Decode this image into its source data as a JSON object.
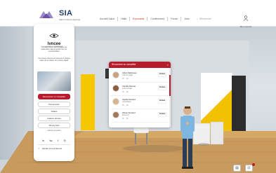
{
  "brand": {
    "logo_text": "SIA",
    "logo_sub": "Salon Internet Agricole"
  },
  "nav": {
    "items": [
      "Accueil Salon",
      "Halls",
      "Exposants",
      "Conférences",
      "Forum",
      "Jobs"
    ],
    "active_index": 2,
    "search_label": "Recherche",
    "account_label": "Mon compte"
  },
  "exhibitor": {
    "logo_text": "lvncee",
    "logo_sub": "CONSEIL & INGÉNIERIE",
    "desc1": "IVNCEE conseil, accompagne vos partenaires dans la gestion de vos communication.",
    "desc2": "Une équipe d'expert est présente à chaque étape de la création du contenu digital.",
    "primary_button": "Rencontrer un conseiller",
    "buttons": [
      "Documents",
      "Vidéos",
      "Galerie photos",
      "Temps forts"
    ],
    "address": "Adresse exposant",
    "socials": [
      "in",
      "tw",
      "f",
      "◎"
    ],
    "favorite_label": "Ajouter à mes favoris"
  },
  "contacts": {
    "title": "Rencontrer un conseiller",
    "close_label": "×",
    "items": [
      {
        "name": "Julien Martineau",
        "role": "Chef de projet",
        "icons": "✉ ☏",
        "logo": "lvncee"
      },
      {
        "name": "Camille Dumas",
        "role": "Commerciale",
        "icons": "✉ ☏",
        "logo": "lvncee"
      },
      {
        "name": "Sophie Renard",
        "role": "Consultante",
        "icons": "✉ ☏",
        "logo": "lvncee"
      },
      {
        "name": "Olivier Ferrand",
        "role": "Directeur",
        "icons": "✉ ☏",
        "logo": "lvncee"
      }
    ]
  },
  "controls": {
    "chat_label": "▤",
    "settings_label": "⊡"
  },
  "colors": {
    "accent": "#b71c2c",
    "brand_blue": "#1f3a6b",
    "booth_yellow": "#f4c700"
  }
}
